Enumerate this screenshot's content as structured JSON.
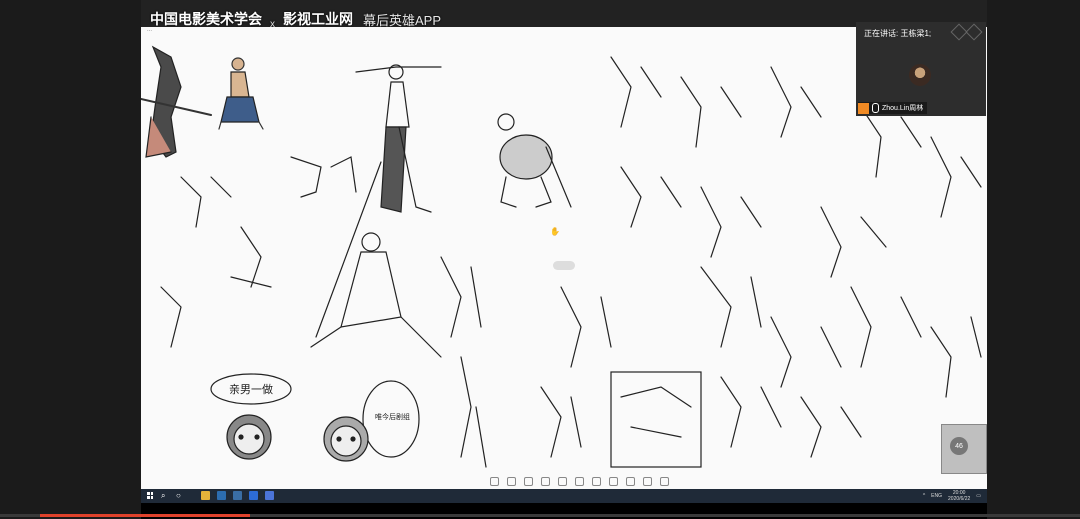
{
  "branding": {
    "org": "中国电影美术学会",
    "separator": "x",
    "site": "影视工业网",
    "app": "幕后英雄APP"
  },
  "canvas": {
    "caption": "...",
    "doodle_text_1": "亲男一做",
    "doodle_text_2": "唯今后剧组"
  },
  "speaker": {
    "label": "正在讲话: 王栋梁1;",
    "participant_name": "Zhou.Lin周林"
  },
  "mini_video": {
    "badge": "46"
  },
  "taskbar": {
    "language": "ENG",
    "time": "20:00",
    "date": "2020/6/22",
    "apps": [
      {
        "name": "file-explorer-icon",
        "color": "#e5b33a"
      },
      {
        "name": "photoshop-icon",
        "color": "#2c6db0"
      },
      {
        "name": "app-blue-icon",
        "color": "#3a6ea5"
      },
      {
        "name": "app-window-icon",
        "color": "#2d6cd6"
      },
      {
        "name": "meeting-app-icon",
        "color": "#4b74d9"
      }
    ]
  },
  "progress": {
    "fraction": 0.21,
    "color": "#e0422b"
  }
}
